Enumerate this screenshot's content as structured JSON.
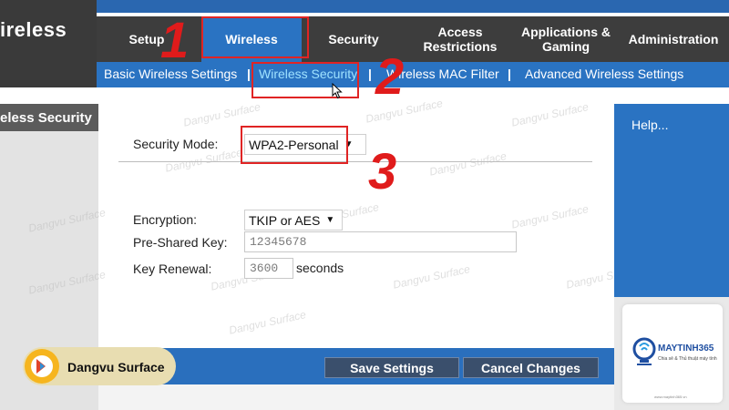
{
  "brand": {
    "title": "ireless"
  },
  "section_title": "eless Security",
  "tabs": [
    {
      "label": "Setup"
    },
    {
      "label": "Wireless"
    },
    {
      "label": "Security"
    },
    {
      "label": "Access Restrictions"
    },
    {
      "label": "Applications & Gaming"
    },
    {
      "label": "Administration"
    }
  ],
  "subnav": {
    "items": [
      {
        "label": "Basic Wireless Settings"
      },
      {
        "label": "Wireless Security"
      },
      {
        "label": "Wireless MAC Filter"
      },
      {
        "label": "Advanced Wireless Settings"
      }
    ],
    "separator": "|"
  },
  "form": {
    "security_mode": {
      "label": "Security Mode:",
      "value": "WPA2-Personal"
    },
    "encryption": {
      "label": "Encryption:",
      "value": "TKIP or AES"
    },
    "psk": {
      "label": "Pre-Shared Key:",
      "value": "12345678"
    },
    "key_renewal": {
      "label": "Key Renewal:",
      "value": "3600",
      "unit": "seconds"
    }
  },
  "help": {
    "link": "Help..."
  },
  "buttons": {
    "save": "Save Settings",
    "cancel": "Cancel Changes"
  },
  "annotations": {
    "n1": "1",
    "n2": "2",
    "n3": "3"
  },
  "watermark": "Dangvu Surface",
  "channel_badge": {
    "name": "Dangvu Surface"
  },
  "logo": {
    "name": "MAYTINH365",
    "tagline": "Chia sẻ & Thủ thuật máy tính",
    "url": "www.maytinh365.vn"
  },
  "colors": {
    "accent_blue": "#2a73c2",
    "annotation_red": "#e02424",
    "dark_header": "#3d3d3d"
  }
}
